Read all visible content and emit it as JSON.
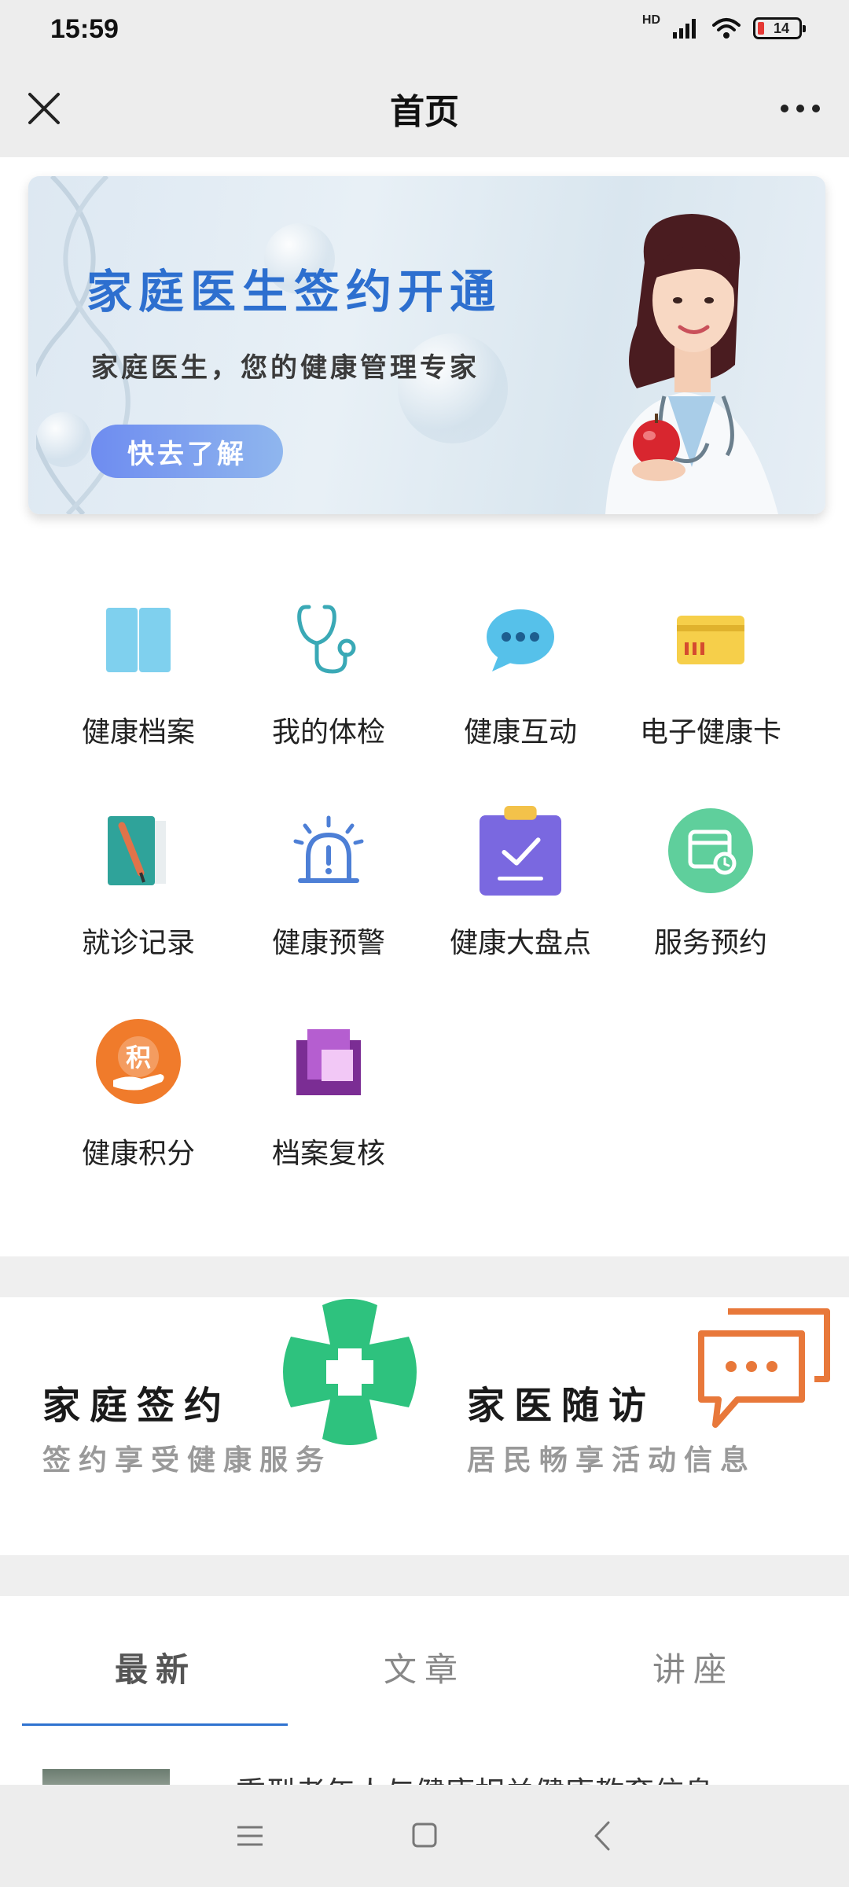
{
  "status_bar": {
    "time": "15:59",
    "battery": "14",
    "network": "HD"
  },
  "nav": {
    "title": "首页"
  },
  "banner": {
    "title": "家庭医生签约开通",
    "subtitle": "家庭医生，您的健康管理专家",
    "button_label": "快去了解"
  },
  "services": [
    {
      "label": "健康档案",
      "icon": "book-icon"
    },
    {
      "label": "我的体检",
      "icon": "stethoscope-icon"
    },
    {
      "label": "健康互动",
      "icon": "chat-bubble-icon"
    },
    {
      "label": "电子健康卡",
      "icon": "card-icon"
    },
    {
      "label": "就诊记录",
      "icon": "notebook-icon"
    },
    {
      "label": "健康预警",
      "icon": "alarm-icon"
    },
    {
      "label": "健康大盘点",
      "icon": "clipboard-check-icon"
    },
    {
      "label": "服务预约",
      "icon": "calendar-clock-icon"
    },
    {
      "label": "健康积分",
      "icon": "points-icon"
    },
    {
      "label": "档案复核",
      "icon": "files-icon"
    }
  ],
  "features": [
    {
      "title": "家庭签约",
      "subtitle": "签约享受健康服务",
      "icon": "medical-cross-icon"
    },
    {
      "title": "家医随访",
      "subtitle": "居民畅享活动信息",
      "icon": "message-icon"
    }
  ],
  "tabs": [
    {
      "label": "最新",
      "active": true
    },
    {
      "label": "文章",
      "active": false
    },
    {
      "label": "讲座",
      "active": false
    }
  ],
  "article": {
    "title": "重型老年人与健康相关健康教育信息"
  },
  "colors": {
    "accent": "#2f73d0",
    "banner_title": "#2d6fcf",
    "green_cross": "#2ec27e",
    "orange_message": "#e8783a"
  }
}
